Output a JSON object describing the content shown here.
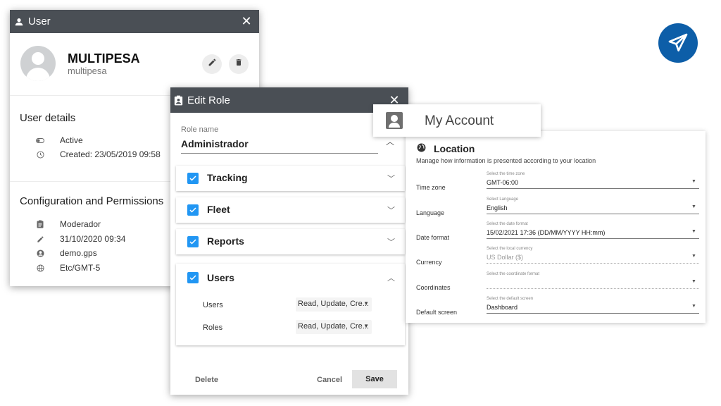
{
  "user_panel": {
    "title": "User",
    "name": "MULTIPESA",
    "handle": "multipesa",
    "details_title": "User details",
    "details": [
      {
        "icon": "toggle-icon",
        "text": "Active"
      },
      {
        "icon": "clock-icon",
        "text": "Created: 23/05/2019 09:58"
      }
    ],
    "config_title": "Configuration and Permissions",
    "config": [
      {
        "icon": "clipboard-icon",
        "text": "Moderador"
      },
      {
        "icon": "pencil-icon",
        "text": "31/10/2020 09:34"
      },
      {
        "icon": "account-circle-icon",
        "text": "demo.gps"
      },
      {
        "icon": "globe-icon",
        "text": "Etc/GMT-5"
      }
    ]
  },
  "edit_role": {
    "title": "Edit Role",
    "role_name_label": "Role name",
    "role_name_value": "Administrador",
    "permissions": [
      {
        "label": "Tracking",
        "checked": true,
        "expanded": false
      },
      {
        "label": "Fleet",
        "checked": true,
        "expanded": false
      },
      {
        "label": "Reports",
        "checked": true,
        "expanded": false
      },
      {
        "label": "Users",
        "checked": true,
        "expanded": true
      }
    ],
    "users_sub": [
      {
        "label": "Users",
        "value": "Read, Update, Cre..."
      },
      {
        "label": "Roles",
        "value": "Read, Update, Cre..."
      }
    ],
    "delete_label": "Delete",
    "cancel_label": "Cancel",
    "save_label": "Save"
  },
  "my_account": {
    "title": "My Account",
    "location_title": "Location",
    "location_desc": "Manage how information is presented according to your location",
    "rows": [
      {
        "label": "Time zone",
        "sublabel": "Select the time zone",
        "value": "GMT-06:00"
      },
      {
        "label": "Language",
        "sublabel": "Select Language",
        "value": "English"
      },
      {
        "label": "Date format",
        "sublabel": "Select the date format",
        "value": "15/02/2021 17:36 (DD/MM/YYYY HH:mm)"
      },
      {
        "label": "Currency",
        "sublabel": "Select the local currency",
        "value": "US Dollar ($)"
      },
      {
        "label": "Coordinates",
        "sublabel": "Select the coordinate format",
        "value": ""
      },
      {
        "label": "Default screen",
        "sublabel": "Select the default screen",
        "value": "Dashboard"
      }
    ]
  },
  "colors": {
    "titlebar": "#4a4f55",
    "checkbox": "#2196f3",
    "logo": "#0d5ea8"
  }
}
